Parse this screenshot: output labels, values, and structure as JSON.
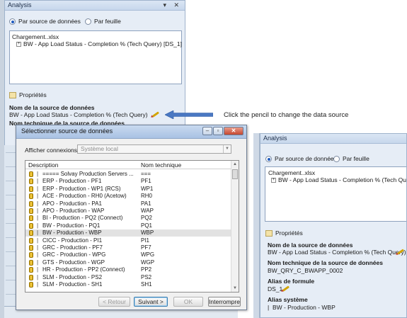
{
  "panel_top": {
    "title": "Analysis",
    "title_controls": "▾ ✕",
    "radio_datasource": "Par source de données",
    "radio_sheet": "Par feuille",
    "tree_file": "Chargement..xlsx",
    "tree_item": "BW - App Load Status - Completion % (Tech Query) [DS_1]",
    "properties_label": "Propriétés",
    "datasource_name_heading": "Nom de la source de données",
    "datasource_name_value": "BW - App Load Status - Completion % (Tech Query)",
    "tech_name_heading": "Nom technique de la source de données"
  },
  "callout": {
    "text": "Click the pencil to change the data source",
    "arrow_color": "#4a78c2"
  },
  "dialog": {
    "title": "Sélectionner source de données",
    "filter_label": "Afficher connexions",
    "filter_value": "Système local",
    "col_description": "Description",
    "col_technical": "Nom technique",
    "rows": [
      {
        "description": "===== Solvay Production Servers ...",
        "technical": "==="
      },
      {
        "description": "ERP - Production - PF1",
        "technical": "PF1"
      },
      {
        "description": "ERP - Production - WP1 (RCS)",
        "technical": "WP1"
      },
      {
        "description": "ACE - Production - RH0 (Acetow)",
        "technical": "RH0"
      },
      {
        "description": "APO - Production - PA1",
        "technical": "PA1"
      },
      {
        "description": "APO - Production - WAP",
        "technical": "WAP"
      },
      {
        "description": "BI - Production - PQ2 (Connect)",
        "technical": "PQ2"
      },
      {
        "description": "BW - Production - PQ1",
        "technical": "PQ1"
      },
      {
        "description": "BW - Production - WBP",
        "technical": "WBP"
      },
      {
        "description": "CICC - Production - PI1",
        "technical": "PI1"
      },
      {
        "description": "GRC - Production - PF7",
        "technical": "PF7"
      },
      {
        "description": "GRC - Production - WPG",
        "technical": "WPG"
      },
      {
        "description": "GTS - Production - WGP",
        "technical": "WGP"
      },
      {
        "description": "HR - Production - PP2 (Connect)",
        "technical": "PP2"
      },
      {
        "description": "SLM - Production - PS2",
        "technical": "PS2"
      },
      {
        "description": "SLM - Production - SH1",
        "technical": "SH1"
      }
    ],
    "selected_row": "BW - Production - WBP",
    "btn_back": "< Retour",
    "btn_next": "Suivant >",
    "btn_ok": "OK",
    "btn_cancel": "Interrompre"
  },
  "panel_right": {
    "title": "Analysis",
    "radio_datasource": "Par source de données",
    "radio_sheet": "Par feuille",
    "tree_file": "Chargement..xlsx",
    "tree_item": "BW - App Load Status - Completion % (Tech Query) [DS_1]",
    "properties_label": "Propriétés",
    "datasource_name_heading": "Nom de la source de données",
    "datasource_name_value": "BW - App Load Status - Completion % (Tech Query)",
    "tech_name_heading": "Nom technique de la source de données",
    "tech_name_value": "BW_QRY_C_BWAPP_0002",
    "formula_alias_heading": "Alias de formule",
    "formula_alias_value": "DS_1",
    "system_alias_heading": "Alias système",
    "system_alias_value": "BW - Production - WBP"
  }
}
